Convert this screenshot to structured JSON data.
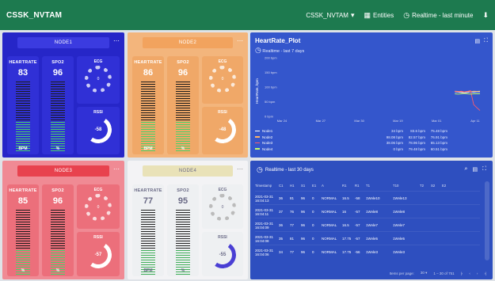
{
  "app": {
    "brand": "CSSK_NVTAM",
    "org_menu": "CSSK_NVTAM",
    "entities_label": "Entities",
    "time_label": "Realtime - last minute"
  },
  "nodes": [
    {
      "title": "NODE1",
      "bg": "#2626c8",
      "header": "#3b3be0",
      "card": "#3030d6",
      "heartrate": {
        "label": "HEARTRATE",
        "value": "83",
        "unit": "BPM"
      },
      "spo2": {
        "label": "SPO2",
        "value": "96",
        "unit": "%"
      },
      "ecg_label": "ECG",
      "ecg_value": "0",
      "rssi_label": "RSSI",
      "rssi_value": "-58"
    },
    {
      "title": "NODE2",
      "bg": "#f3b57c",
      "header": "#f2a35e",
      "card": "#f0a868",
      "heartrate": {
        "label": "HEARTRATE",
        "value": "86",
        "unit": "BPM"
      },
      "spo2": {
        "label": "SPO2",
        "value": "96",
        "unit": "%"
      },
      "ecg_label": "ECG",
      "ecg_value": "0",
      "rssi_label": "RSSI",
      "rssi_value": "-48"
    },
    {
      "title": "NODE3",
      "bg": "#f08a94",
      "header": "#e8424e",
      "card": "#ec6f7b",
      "heartrate": {
        "label": "HEARTRATE",
        "value": "85",
        "unit": "%"
      },
      "spo2": {
        "label": "SPO2",
        "value": "96",
        "unit": "%"
      },
      "ecg_label": "ECG",
      "ecg_value": "0",
      "rssi_label": "RSSI",
      "rssi_value": "-57"
    },
    {
      "title": "NODE4",
      "bg": "#f3f3f5",
      "header": "#e9e2b8",
      "card": "#eef0f2",
      "heartrate": {
        "label": "HEARTRATE",
        "value": "77",
        "unit": "BPM"
      },
      "spo2": {
        "label": "SPO2",
        "value": "95",
        "unit": "%"
      },
      "ecg_label": "ECG",
      "ecg_value": "0",
      "rssi_label": "RSSI",
      "rssi_value": "-55"
    }
  ],
  "chart_data": {
    "type": "line",
    "title": "HeartRate_Plot",
    "subtitle": "Realtime - last 7 days",
    "ylabel": "HeartRate, bpm",
    "y_ticks": [
      "200 bpm",
      "150 bpm",
      "100 bpm",
      "50 bpm",
      "0 bpm"
    ],
    "ylim": [
      0,
      200
    ],
    "x_ticks": [
      "Mar 24",
      "Mar 27",
      "Mar 30",
      "Mar 19",
      "Mar 01",
      "Apr 11"
    ],
    "legend_headers": [
      "",
      "",
      ""
    ],
    "series": [
      {
        "name": "Node1",
        "color": "#ffffff",
        "values": [
          null,
          null,
          null,
          null,
          null,
          null,
          null,
          null,
          null,
          null,
          null,
          null,
          null,
          null,
          null,
          null,
          null,
          null,
          null,
          null,
          null,
          null,
          null,
          null,
          null,
          null,
          null,
          null,
          null,
          null,
          null,
          null,
          null,
          null,
          null,
          null,
          null,
          null,
          null,
          null,
          null,
          null,
          null,
          null,
          null,
          null,
          null,
          null,
          null,
          null,
          null,
          null,
          null,
          null,
          null,
          null,
          84,
          83,
          82,
          80,
          82,
          84,
          83,
          84,
          84
        ],
        "stats": [
          "34 bpm",
          "83.6 bpm",
          "75.48 bpm"
        ]
      },
      {
        "name": "Node2",
        "color": "#ffb366",
        "values": [
          null,
          null,
          null,
          null,
          null,
          null,
          null,
          null,
          null,
          null,
          null,
          null,
          null,
          null,
          null,
          null,
          null,
          null,
          null,
          null,
          null,
          null,
          null,
          null,
          null,
          null,
          null,
          null,
          null,
          null,
          null,
          null,
          null,
          null,
          null,
          null,
          null,
          null,
          null,
          null,
          null,
          null,
          null,
          null,
          null,
          null,
          null,
          null,
          null,
          null,
          null,
          null,
          null,
          null,
          null,
          null,
          86,
          85,
          84,
          83,
          85,
          84,
          86,
          85,
          86
        ],
        "stats": [
          "98.08 bpm",
          "82.57 bpm",
          "76.91 bpm"
        ]
      },
      {
        "name": "Node3",
        "color": "#ff5a6a",
        "values": [
          null,
          null,
          null,
          null,
          null,
          null,
          null,
          null,
          null,
          null,
          null,
          null,
          null,
          null,
          null,
          null,
          null,
          null,
          null,
          null,
          null,
          null,
          null,
          null,
          null,
          null,
          null,
          null,
          null,
          null,
          null,
          null,
          null,
          null,
          null,
          null,
          null,
          null,
          null,
          null,
          null,
          null,
          null,
          null,
          null,
          null,
          null,
          null,
          null,
          null,
          null,
          null,
          null,
          null,
          null,
          null,
          85,
          84,
          86,
          84,
          85,
          88,
          40,
          30,
          20
        ],
        "stats": [
          "38.06 bpm",
          "78.96 bpm",
          "65.13 bpm"
        ]
      },
      {
        "name": "Node4",
        "color": "#c3ff6a",
        "values": [
          null,
          null,
          null,
          null,
          null,
          null,
          null,
          null,
          null,
          null,
          null,
          null,
          null,
          null,
          null,
          null,
          null,
          null,
          null,
          null,
          null,
          null,
          null,
          null,
          null,
          null,
          null,
          null,
          null,
          null,
          null,
          null,
          null,
          null,
          null,
          null,
          null,
          null,
          null,
          null,
          null,
          null,
          null,
          null,
          null,
          null,
          null,
          null,
          null,
          null,
          null,
          null,
          null,
          null,
          null,
          null,
          77,
          76,
          77,
          78,
          77,
          76,
          77,
          77,
          77
        ],
        "stats": [
          "0 bpm",
          "79.48 bpm",
          "60.51 bpm"
        ]
      }
    ],
    "grid": false
  },
  "table": {
    "title": "Realtime - last 30 days",
    "columns": [
      "Timestamp",
      "C1",
      "H1",
      "S1",
      "E1",
      "A",
      "R1",
      "R1",
      "T1",
      "T10",
      "T2",
      "S2",
      "E2"
    ],
    "rows": [
      [
        "2021-03-31 16:04:13",
        "36",
        "81",
        "96",
        "0",
        "NORMAL",
        "16.5",
        "-58",
        "1Wvle10",
        "1Wvle13",
        "",
        "",
        ""
      ],
      [
        "2021-03-31 16:04:11",
        "37",
        "76",
        "96",
        "0",
        "NORMAL",
        "16",
        "-57",
        "1Wvle8",
        "1Wvle8",
        "",
        "",
        ""
      ],
      [
        "2021-03-31 16:04:09",
        "36",
        "77",
        "96",
        "0",
        "NORMAL",
        "16.5",
        "-57",
        "1Wvle7",
        "1Wvle7",
        "",
        "",
        ""
      ],
      [
        "2021-03-31 16:04:08",
        "35",
        "81",
        "96",
        "0",
        "NORMAL",
        "17.75",
        "-57",
        "1Wvle5",
        "1Wvle5",
        "",
        "",
        ""
      ],
      [
        "2021-03-31 16:04:06",
        "34",
        "77",
        "96",
        "0",
        "NORMAL",
        "17.75",
        "-56",
        "1Wvle3",
        "1Wvle3",
        "",
        "",
        ""
      ]
    ],
    "items_per_page_label": "Items per page:",
    "items_per_page": "30",
    "range_label": "1 – 30 of 751"
  }
}
